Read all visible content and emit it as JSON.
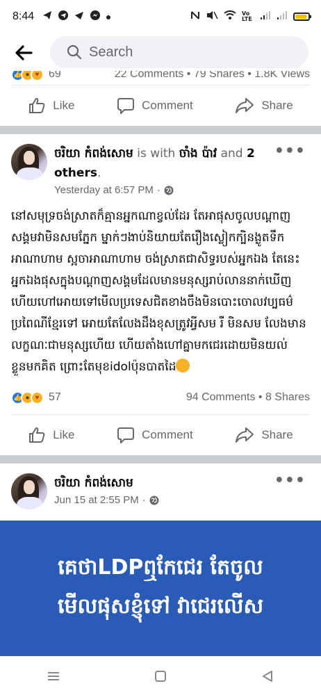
{
  "status_bar": {
    "time": "8:44",
    "left_icons": [
      "telegram-icon",
      "telegram-icon",
      "send-icon",
      "messenger-icon",
      "dot-icon"
    ],
    "right_icons": [
      "nfc-icon",
      "mute-icon",
      "wifi-icon",
      "volte-icon",
      "signal-icon",
      "signal-icon",
      "battery-icon"
    ],
    "volte_label": "Vo LTE"
  },
  "header": {
    "back_icon": "arrow-left-icon",
    "search_placeholder": "Search"
  },
  "top_post_partial": {
    "reaction_count": "69",
    "comments": "22 Comments",
    "shares": "79 Shares",
    "views": "1.8K Views"
  },
  "actions": {
    "like": "Like",
    "comment": "Comment",
    "share": "Share"
  },
  "post1": {
    "author": "ចរិយា កំពង់សោម",
    "with_text": "is with",
    "tagged": "ចាំង ប៉ាវ",
    "and_text": "and",
    "others": "2 others",
    "period": ".",
    "timestamp": "Yesterday at 6:57 PM",
    "privacy_icon": "globe-icon",
    "body": "នៅសមុទ្រចង់ស្រាតក៏គ្មានអ្នកណាខ្វល់ដែរ តែអាផុសចូលបណ្ដាញសង្គមវាមិនសមភ្នែក ម្នាក់ៗងាប់និយាយតែរឿងស្លៀកក្បិនង្ងូតទឹក អាណាហាម ស្អចាអាណាហាម ចង់ស្រាតជាសិទ្ធរបស់អ្នកឯង តែនេះអ្នកឯងផុសក្នុងបណ្តាញសង្គមដែលមានមនុស្សរាប់លាននាក់ឃើញ ហើយហៅអោយទៅមើលប្រទេសជិតខាងចឹងមិនបោះចោលវប្បធម៌ប្រពៃណីខ្មែរទៅ អោយតែលែងដឹងខុសត្រូវអ្វីសម រឺ មិនសម លែងមានលក្ខណៈជាមនុស្សហើយ ហើយតាំងហៅគ្នាមកជេរដោយមិនយល់ខ្លួនមកគិត ព្រោះតែមុខidolប៉ុនបាតដៃ",
    "reaction_count": "57",
    "comments": "94 Comments",
    "shares": "8 Shares"
  },
  "post2": {
    "author": "ចរិយា កំពង់សោម",
    "timestamp": "Jun 15 at 2:55 PM",
    "image_line1": "គេថាLDPឮកែជេរ តែចូល",
    "image_line2": "មើលផុសខ្ញុំទៅ វាជេរលើស",
    "image_bg": "#2a5bb7"
  },
  "colors": {
    "accent": "#1877f2",
    "secondary_text": "#65676b",
    "separator": "#c9ccd1"
  },
  "nav": {
    "menu_icon": "menu-icon",
    "home_icon": "square-icon",
    "back_icon": "triangle-back-icon"
  }
}
